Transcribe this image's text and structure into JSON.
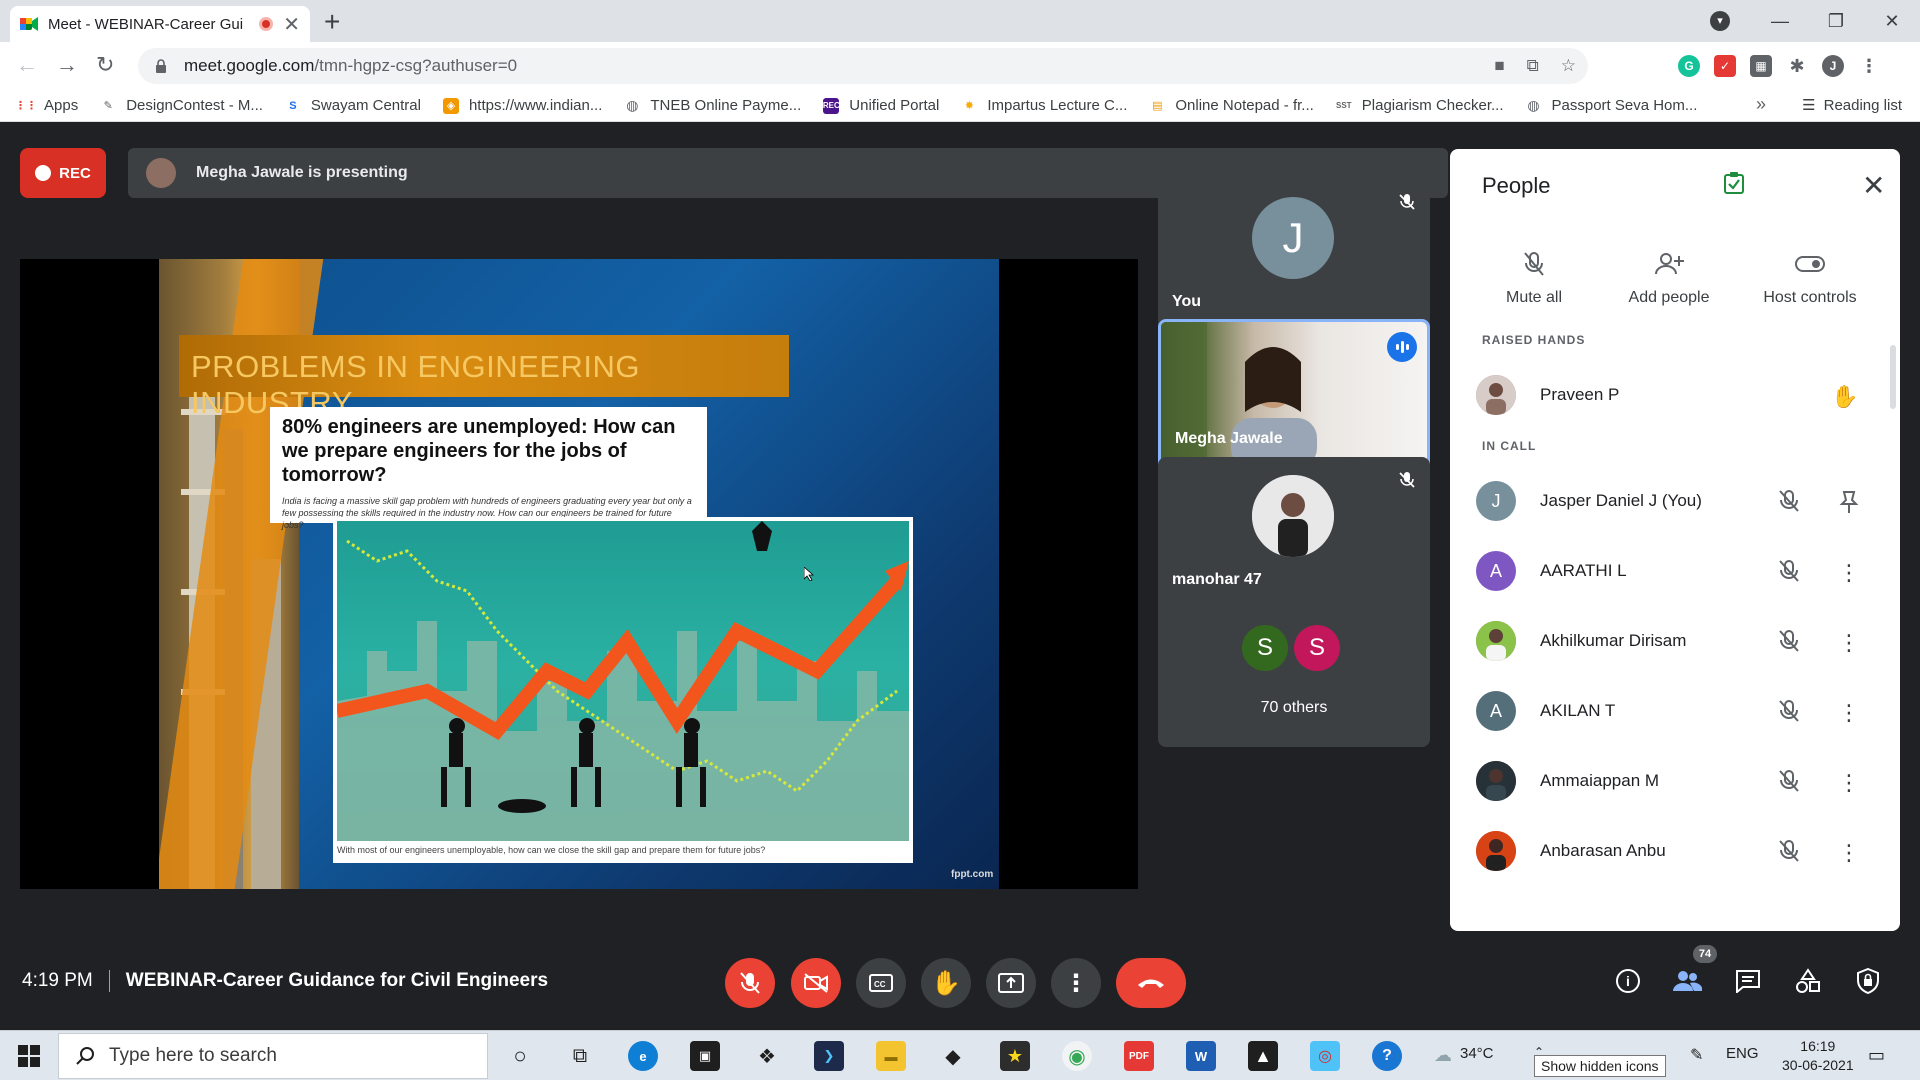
{
  "browser": {
    "tab_title": "Meet - WEBINAR-Career Gui",
    "url_host": "meet.google.com",
    "url_path": "/tmn-hgpz-csg?authuser=0",
    "profile_initial": "J",
    "bookmarks": [
      {
        "label": "Apps",
        "icon": "apps-grid-icon",
        "color": "#ea4335"
      },
      {
        "label": "DesignContest - M...",
        "icon": "designcontest-icon",
        "color": "#5f6368"
      },
      {
        "label": "Swayam Central",
        "icon": "swayam-icon",
        "color": "#1a73e8"
      },
      {
        "label": "https://www.indian...",
        "icon": "indian-site-icon",
        "color": "#f29900"
      },
      {
        "label": "TNEB Online Payme...",
        "icon": "globe-icon",
        "color": "#5f6368"
      },
      {
        "label": "Unified Portal",
        "icon": "rec-portal-icon",
        "color": "#4a148c"
      },
      {
        "label": "Impartus Lecture C...",
        "icon": "impartus-icon",
        "color": "#f9ab00"
      },
      {
        "label": "Online Notepad - fr...",
        "icon": "notepad-icon",
        "color": "#fbbc04"
      },
      {
        "label": "Plagiarism Checker...",
        "icon": "sst-icon",
        "color": "#5f6368"
      },
      {
        "label": "Passport Seva Hom...",
        "icon": "globe-icon",
        "color": "#5f6368"
      }
    ],
    "more_bookmarks": "»",
    "reading_list": "Reading list"
  },
  "meet": {
    "rec_label": "REC",
    "presenting_text": "Megha Jawale is presenting",
    "slide": {
      "title": "PROBLEMS IN ENGINEERING INDUSTRY",
      "headline": "80% engineers are unemployed: How can we prepare engineers for the jobs of tomorrow?",
      "body": "India is facing a massive skill gap problem with hundreds of engineers graduating every year but only a few possessing the skills required in the industry now. How can our engineers be trained for future jobs?",
      "caption": "With most of our engineers unemployable, how can we close the skill gap and prepare them for future jobs?",
      "watermark": "fppt.com"
    },
    "tiles": {
      "you": {
        "initial": "J",
        "name": "You"
      },
      "megha": {
        "name": "Megha Jawale"
      },
      "manohar": {
        "name": "manohar 47"
      },
      "others": {
        "avatars": [
          "S",
          "S"
        ],
        "label": "70 others"
      }
    },
    "people": {
      "title": "People",
      "actions": [
        {
          "label": "Mute all",
          "icon": "mic-off-icon"
        },
        {
          "label": "Add people",
          "icon": "add-person-icon"
        },
        {
          "label": "Host controls",
          "icon": "toggle-icon"
        }
      ],
      "raised_hands_header": "RAISED HANDS",
      "raised_hands": [
        {
          "name": "Praveen P"
        }
      ],
      "in_call_header": "IN CALL",
      "in_call": [
        {
          "name": "Jasper Daniel J (You)",
          "initial": "J",
          "color": "#78909c"
        },
        {
          "name": "AARATHI L",
          "initial": "A",
          "color": "#7e57c2"
        },
        {
          "name": "Akhilkumar Dirisam",
          "initial": "",
          "color": "#6d7a3b"
        },
        {
          "name": "AKILAN T",
          "initial": "A",
          "color": "#546e7a"
        },
        {
          "name": "Ammaiappan M",
          "initial": "",
          "color": "#3e2723"
        },
        {
          "name": "Anbarasan Anbu",
          "initial": "",
          "color": "#bf360c"
        }
      ]
    },
    "bottom": {
      "time": "4:19 PM",
      "meeting_title": "WEBINAR-Career Guidance for Civil Engineers",
      "participant_count": "74"
    }
  },
  "taskbar": {
    "search_placeholder": "Type here to search",
    "weather": "34°C",
    "language": "ENG",
    "time": "16:19",
    "date": "30-06-2021",
    "tooltip": "Show hidden icons"
  }
}
